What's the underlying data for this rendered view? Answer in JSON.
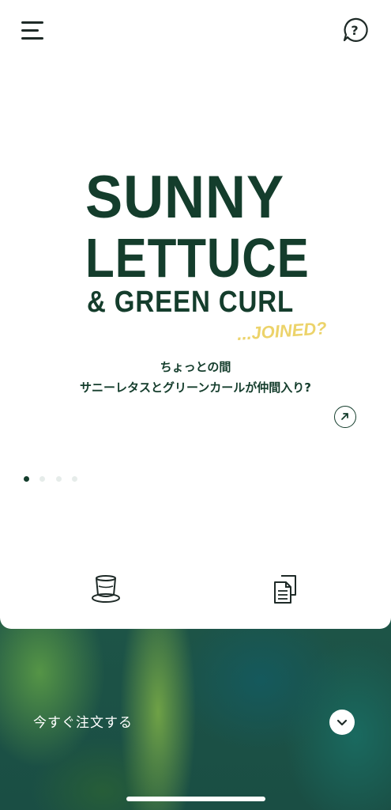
{
  "header": {
    "menu_icon": "hamburger-menu-icon",
    "help_icon": "question-bubble-icon"
  },
  "hero": {
    "line1": "SUNNY",
    "line2": "LETTUCE",
    "line3": "& GREEN CURL",
    "tagline": "...JOINED?",
    "desc_line1": "ちょっとの間",
    "desc_line2": "サニーレタスとグリーンカールが仲間入り?",
    "link_icon": "arrow-up-right-icon"
  },
  "carousel": {
    "pages": 4,
    "active_index": 0
  },
  "bottom_icons": [
    "cup-icon",
    "documents-icon"
  ],
  "order": {
    "label": "今すぐ注文する",
    "button_icon": "chevron-down-icon"
  },
  "colors": {
    "brand_green": "#143d2c",
    "accent_yellow": "#ecd36a"
  }
}
